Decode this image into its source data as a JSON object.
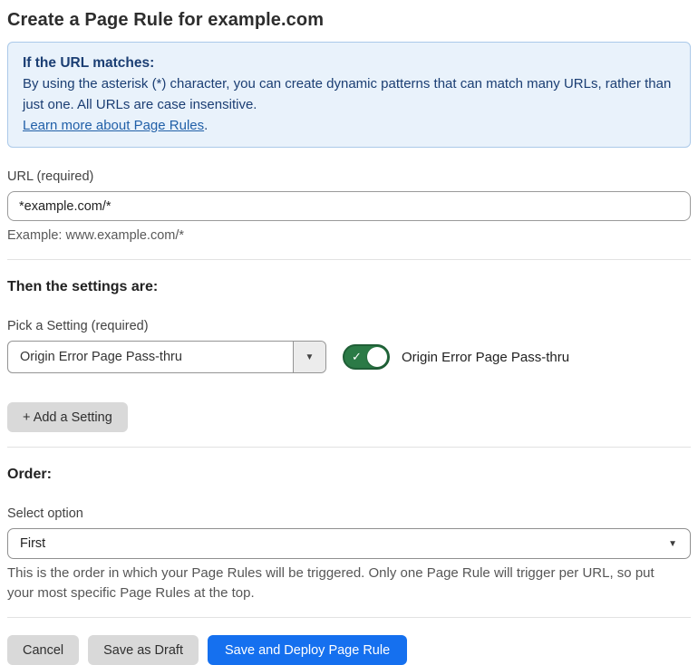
{
  "page": {
    "title": "Create a Page Rule for example.com"
  },
  "info_box": {
    "heading": "If the URL matches:",
    "body": "By using the asterisk (*) character, you can create dynamic patterns that can match many URLs, rather than just one. All URLs are case insensitive.",
    "link_text": "Learn more about Page Rules",
    "link_suffix": "."
  },
  "url_section": {
    "label": "URL (required)",
    "value": "*example.com/*",
    "helper": "Example: www.example.com/*"
  },
  "settings_section": {
    "heading": "Then the settings are:",
    "pick_label": "Pick a Setting (required)",
    "selected_setting": "Origin Error Page Pass-thru",
    "toggle_state": "on",
    "toggle_label": "Origin Error Page Pass-thru",
    "add_button_label": "+ Add a Setting"
  },
  "order_section": {
    "heading": "Order:",
    "select_label": "Select option",
    "selected_option": "First",
    "helper": "This is the order in which your Page Rules will be triggered. Only one Page Rule will trigger per URL, so put your most specific Page Rules at the top."
  },
  "footer": {
    "cancel_label": "Cancel",
    "save_draft_label": "Save as Draft",
    "save_deploy_label": "Save and Deploy Page Rule"
  },
  "icons": {
    "chevron_down": "▼",
    "check": "✓"
  },
  "colors": {
    "info-bg": "#e9f2fb",
    "info-border": "#abc9e9",
    "info-text": "#1b3e73",
    "link-blue": "#2160a8",
    "toggle-green": "#2b7a46",
    "toggle-green-border": "#1f5e36",
    "primary-blue": "#1570ef",
    "button-gray": "#d9d9d9"
  }
}
